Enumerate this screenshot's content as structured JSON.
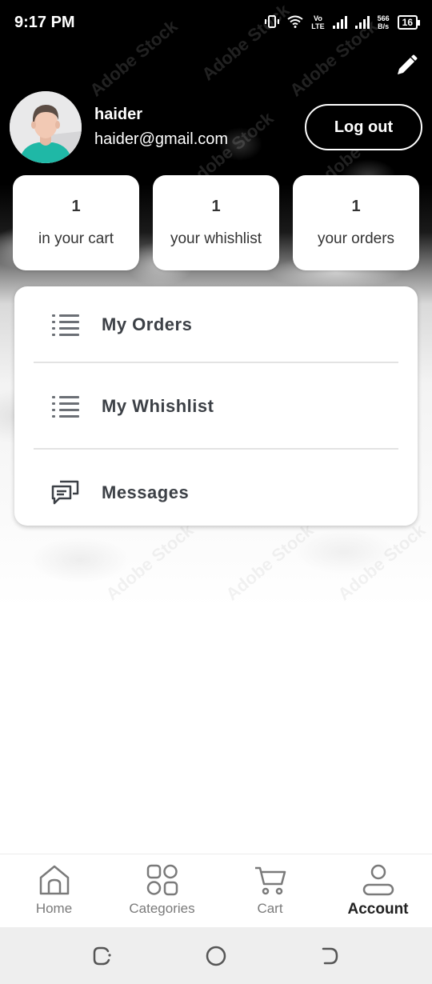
{
  "status_bar": {
    "time": "9:17 PM",
    "network_label_top": "Vo",
    "network_label_bottom": "LTE",
    "speed_value": "566",
    "speed_unit": "B/s",
    "battery": "16"
  },
  "watermark_text": "Adobe Stock",
  "profile": {
    "name": "haider",
    "email": "haider@gmail.com",
    "logout_label": "Log out"
  },
  "stats": [
    {
      "count": "1",
      "label": "in your cart"
    },
    {
      "count": "1",
      "label": "your whishlist"
    },
    {
      "count": "1",
      "label": "your orders"
    }
  ],
  "menu": [
    {
      "label": "My Orders",
      "icon": "list-icon"
    },
    {
      "label": "My Whishlist",
      "icon": "list-icon"
    },
    {
      "label": "Messages",
      "icon": "chat-icon"
    }
  ],
  "bottom_nav": [
    {
      "label": "Home",
      "icon": "home-icon",
      "active": false
    },
    {
      "label": "Categories",
      "icon": "categories-icon",
      "active": false
    },
    {
      "label": "Cart",
      "icon": "cart-icon",
      "active": false
    },
    {
      "label": "Account",
      "icon": "account-icon",
      "active": true
    }
  ],
  "colors": {
    "header_bg": "#000000",
    "card_bg": "#ffffff",
    "text_dark": "#333333",
    "nav_inactive": "#7a7a7a",
    "avatar_shirt": "#1fb8a6"
  }
}
